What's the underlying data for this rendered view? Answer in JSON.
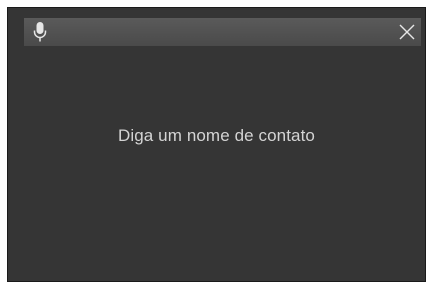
{
  "dialog": {
    "prompt_text": "Diga um nome de contato",
    "close_label": "X"
  },
  "icons": {
    "mic": "microphone-icon",
    "close": "close-icon"
  },
  "colors": {
    "background": "#353535",
    "topbar": "#505050",
    "text": "#d4d4d4",
    "icon": "#e6e6e6"
  }
}
